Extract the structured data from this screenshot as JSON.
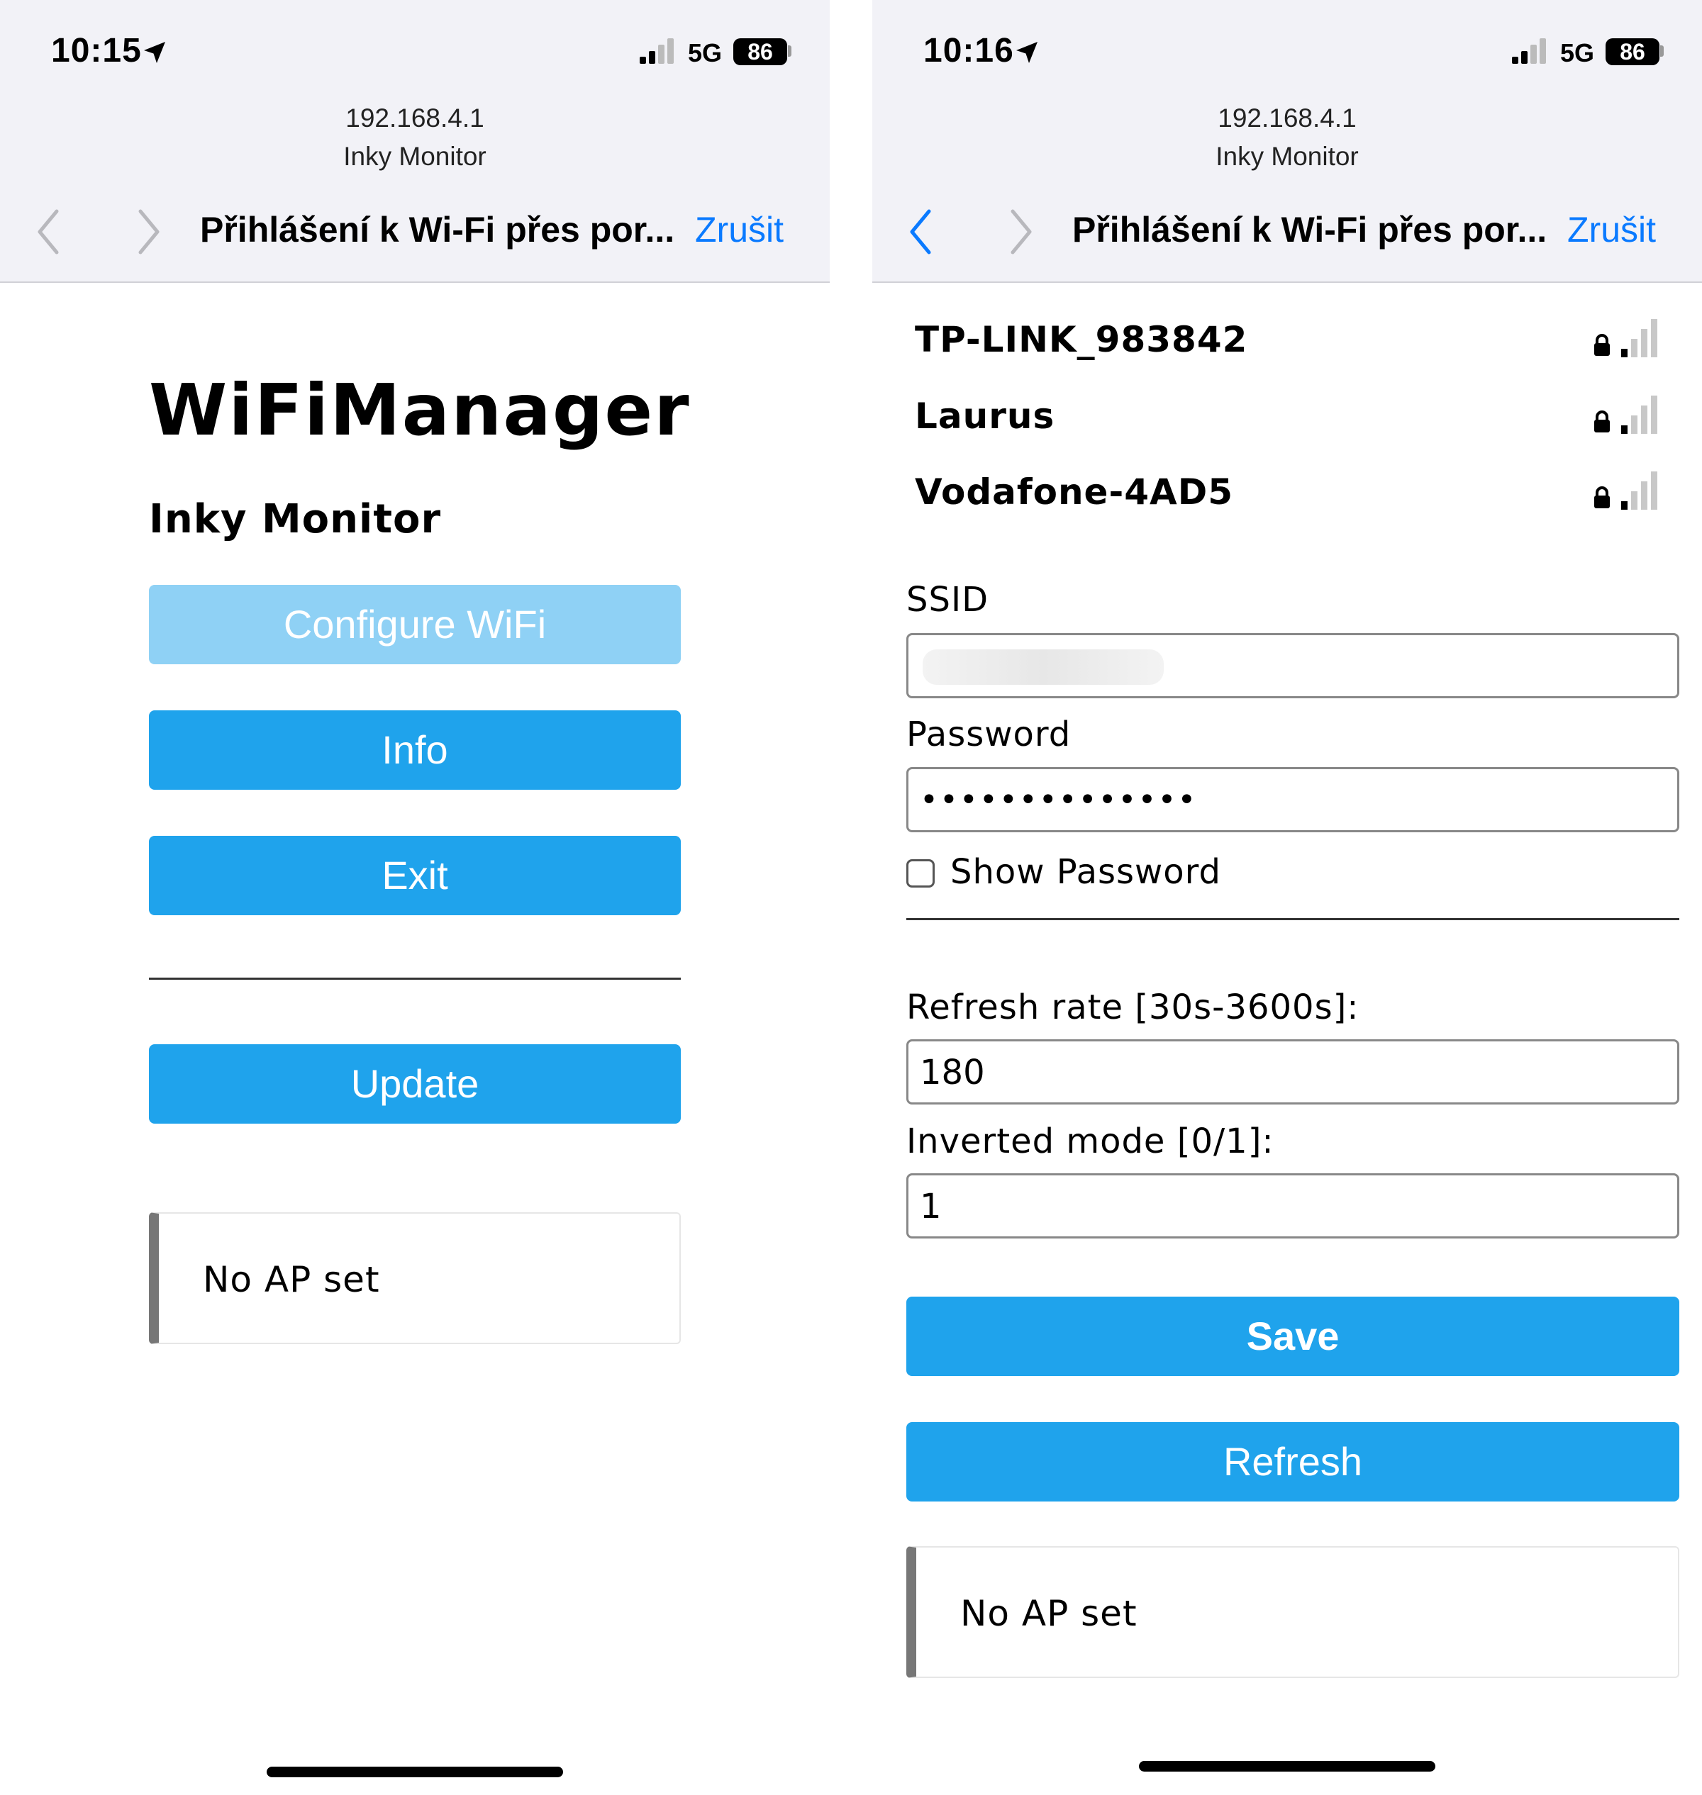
{
  "phone1": {
    "status": {
      "time": "10:15",
      "network": "5G",
      "battery": "86"
    },
    "address": {
      "url": "192.168.4.1",
      "site": "Inky Monitor"
    },
    "nav": {
      "title": "Přihlášení k Wi-Fi přes por...",
      "cancel": "Zrušit"
    },
    "page": {
      "title": "WiFiManager",
      "subtitle": "Inky Monitor",
      "buttons": {
        "configure": "Configure WiFi",
        "info": "Info",
        "exit": "Exit",
        "update": "Update"
      },
      "message": "No AP set"
    }
  },
  "phone2": {
    "status": {
      "time": "10:16",
      "network": "5G",
      "battery": "86"
    },
    "address": {
      "url": "192.168.4.1",
      "site": "Inky Monitor"
    },
    "nav": {
      "title": "Přihlášení k Wi-Fi přes por...",
      "cancel": "Zrušit"
    },
    "networks": [
      {
        "name": "TP-LINK_983842",
        "secured": true,
        "signal_bars": 1
      },
      {
        "name": "Laurus",
        "secured": true,
        "signal_bars": 1
      },
      {
        "name": "Vodafone-4AD5",
        "secured": true,
        "signal_bars": 1
      }
    ],
    "form": {
      "ssid_label": "SSID",
      "ssid_value": "",
      "password_label": "Password",
      "password_value": "••••••••••••••",
      "show_password_label": "Show Password",
      "show_password_checked": false,
      "refresh_label": "Refresh rate [30s-3600s]:",
      "refresh_value": "180",
      "inverted_label": "Inverted mode [0/1]:",
      "inverted_value": "1",
      "save": "Save",
      "refresh": "Refresh"
    },
    "message": "No AP set"
  },
  "colors": {
    "button": "#1fa3ec",
    "button_disabled": "#8fd1f5",
    "link": "#0a7aff",
    "chrome": "#f2f2f7"
  }
}
